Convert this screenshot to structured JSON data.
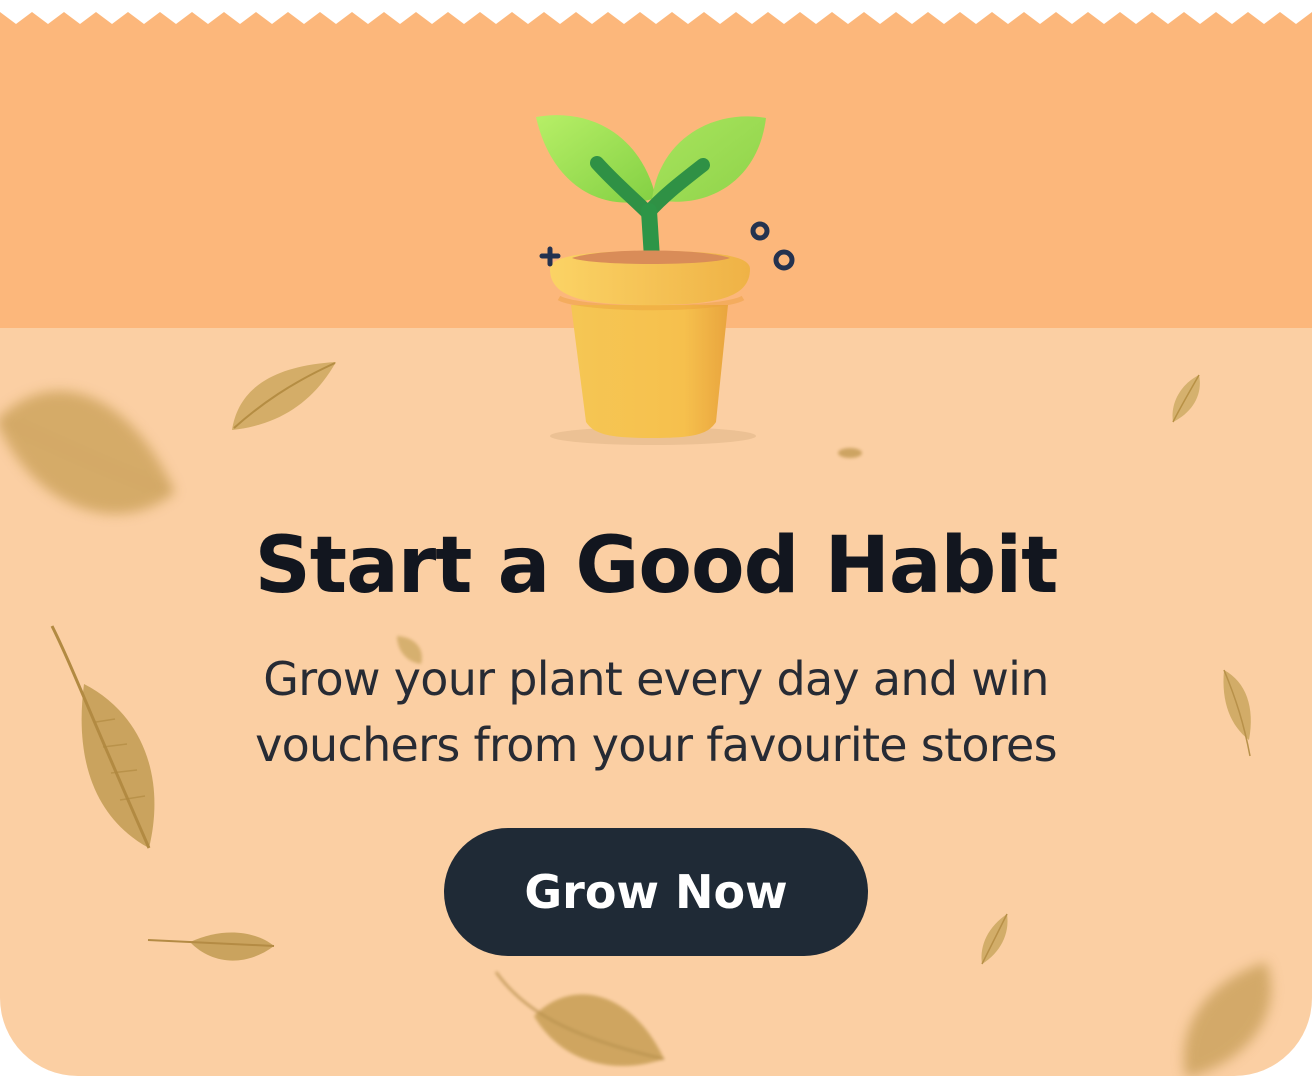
{
  "banner": {
    "heading": "Start a Good Habit",
    "description_lines": [
      "Grow your plant every day and win",
      "vouchers from your favourite stores"
    ],
    "primary_action": {
      "label": "Grow Now"
    },
    "illustration": "plant-pot-icon",
    "decorations": [
      "falling-leaf-icon",
      "plus-sparkle-icon",
      "circle-sparkle-icon"
    ],
    "colors": {
      "top_background": "#fcb77b",
      "body_background": "#fbcfa3",
      "heading": "#12161f",
      "description": "#272b34",
      "button": "#1f2a36",
      "button_text": "#ffffff",
      "leaf": "#c99f55",
      "plant_leaf": "#9ee05b",
      "pot": "#f6c04c"
    }
  }
}
